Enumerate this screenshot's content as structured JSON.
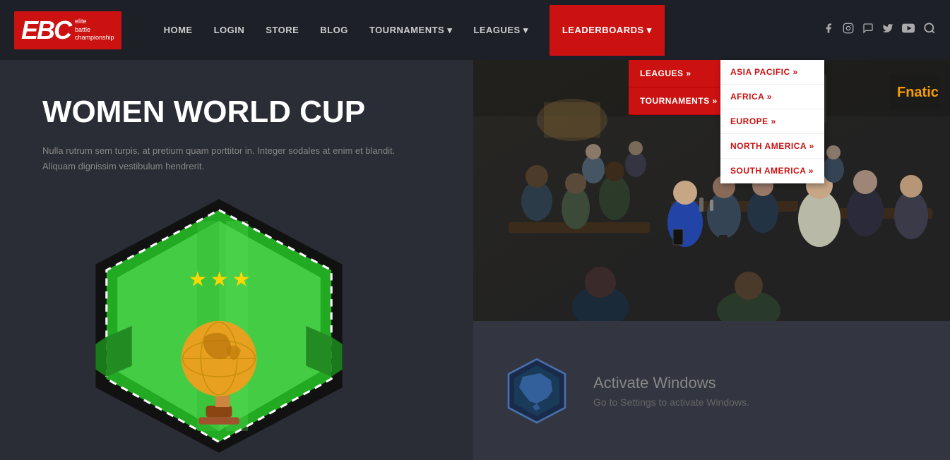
{
  "logo": {
    "ebc_text": "EBC",
    "subtitle_line1": "elite",
    "subtitle_line2": "battle",
    "subtitle_line3": "championship"
  },
  "nav": {
    "items": [
      {
        "label": "HOME",
        "id": "home"
      },
      {
        "label": "LOGIN",
        "id": "login"
      },
      {
        "label": "STORE",
        "id": "store"
      },
      {
        "label": "BLOG",
        "id": "blog"
      },
      {
        "label": "TOURNAMENTS ▾",
        "id": "tournaments"
      },
      {
        "label": "LEAGUES ▾",
        "id": "leagues"
      },
      {
        "label": "LEADERBOARDS ▾",
        "id": "leaderboards",
        "active": true
      }
    ]
  },
  "social_icons": [
    {
      "name": "facebook-icon",
      "glyph": "f"
    },
    {
      "name": "instagram-icon",
      "glyph": "📷"
    },
    {
      "name": "viber-icon",
      "glyph": "📞"
    },
    {
      "name": "twitter-icon",
      "glyph": "t"
    },
    {
      "name": "youtube-icon",
      "glyph": "▶"
    },
    {
      "name": "search-icon",
      "glyph": "🔍"
    }
  ],
  "leaderboards_dropdown": {
    "items": [
      {
        "label": "LEAGUES »",
        "id": "leagues-dd"
      },
      {
        "label": "TOURNAMENTS »",
        "id": "tournaments-dd",
        "has_submenu": true
      }
    ]
  },
  "tournaments_submenu": {
    "items": [
      {
        "label": "ASIA PACIFIC »",
        "id": "asia-pacific"
      },
      {
        "label": "AFRICA »",
        "id": "africa"
      },
      {
        "label": "EUROPE »",
        "id": "europe"
      },
      {
        "label": "NORTH AMERICA »",
        "id": "north-america",
        "active": true
      },
      {
        "label": "SOUTH AMERICA »",
        "id": "south-america"
      }
    ]
  },
  "hero": {
    "title": "WOMEN WORLD CUP",
    "description": "Nulla rutrum sem turpis, at pretium quam porttitor in. Integer sodales at enim et blandit. Aliquam dignissim vestibulum hendrerit."
  },
  "activate": {
    "title": "Activate Windows",
    "description": "Go to Settings to activate Windows."
  }
}
